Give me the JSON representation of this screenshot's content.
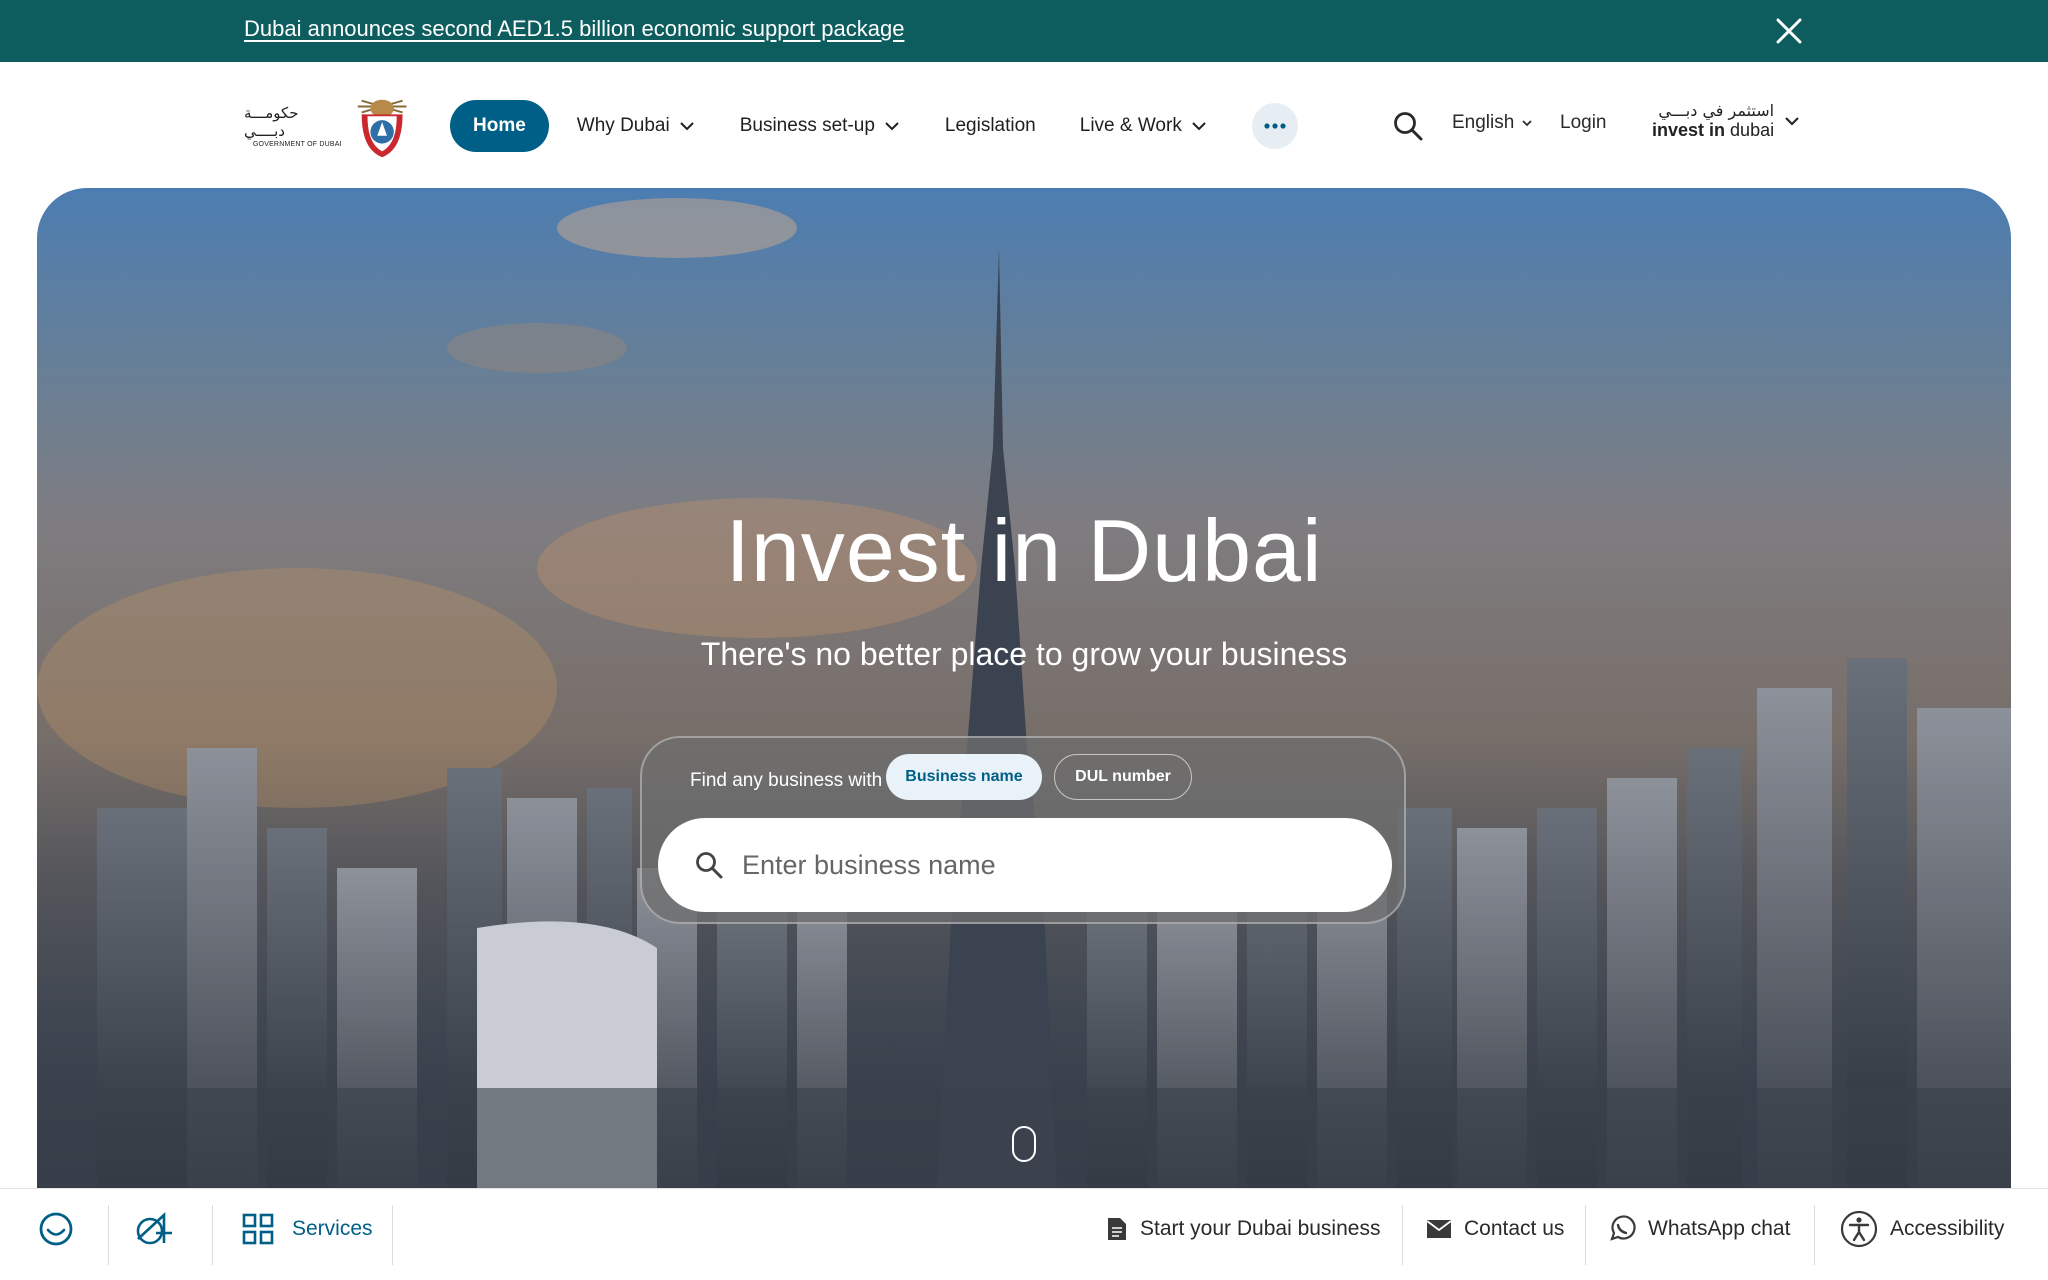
{
  "announcement": {
    "text": "Dubai announces second AED1.5 billion economic support package",
    "close_icon": "close-icon"
  },
  "header": {
    "logo": {
      "arabic": "حكومـــة دبــــي",
      "english": "GOVERNMENT OF DUBAI"
    },
    "nav": {
      "home": "Home",
      "why_dubai": "Why Dubai",
      "business_setup": "Business set-up",
      "legislation": "Legislation",
      "live_work": "Live & Work",
      "more": "•••"
    },
    "language": "English",
    "login": "Login",
    "brand": {
      "arabic": "استثمر في دبـــي",
      "english_bold": "invest in",
      "english_light": "dubai"
    }
  },
  "hero": {
    "title": "Invest in Dubai",
    "subtitle": "There's no better place to grow your business",
    "search": {
      "find_label": "Find any business with",
      "tab_business_name": "Business name",
      "tab_dul_number": "DUL number",
      "placeholder": "Enter business name"
    }
  },
  "bottom_bar": {
    "services": "Services",
    "start_business": "Start your Dubai business",
    "contact": "Contact us",
    "whatsapp": "WhatsApp chat",
    "accessibility": "Accessibility"
  },
  "colors": {
    "announcement_bg": "#0d5c5e",
    "primary": "#005f86",
    "pill_active_bg": "#e8f2f8"
  }
}
